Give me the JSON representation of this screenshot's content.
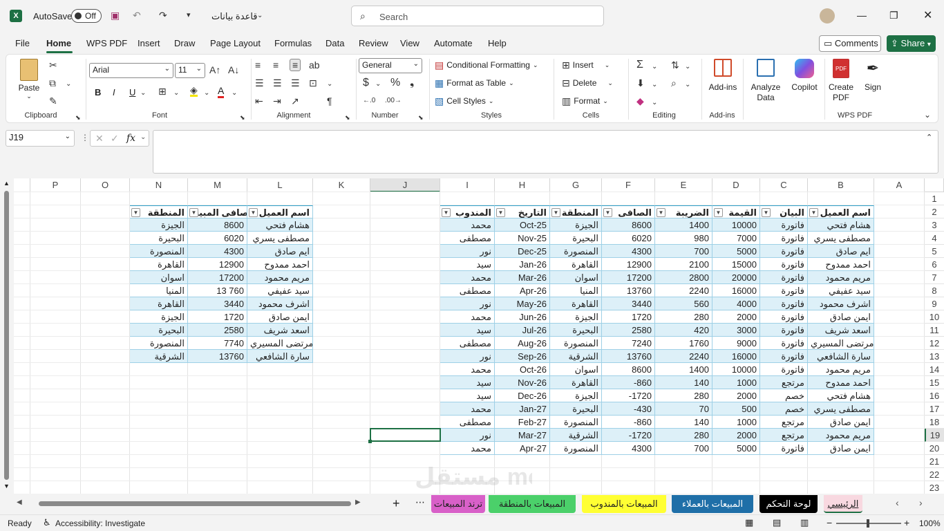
{
  "titlebar": {
    "autosave_label": "AutoSave",
    "autosave_state": "Off",
    "file_name": "قاعدة بيانات",
    "search_placeholder": "Search"
  },
  "menu": [
    "File",
    "Home",
    "WPS PDF",
    "Insert",
    "Draw",
    "Page Layout",
    "Formulas",
    "Data",
    "Review",
    "View",
    "Automate",
    "Help"
  ],
  "menu_active": "Home",
  "comments_label": "Comments",
  "share_label": "Share",
  "ribbon": {
    "clipboard": {
      "label": "Clipboard",
      "paste": "Paste"
    },
    "font": {
      "label": "Font",
      "name": "Arial",
      "size": "11"
    },
    "alignment": {
      "label": "Alignment"
    },
    "number": {
      "label": "Number",
      "format": "General"
    },
    "styles": {
      "label": "Styles",
      "cond": "Conditional Formatting",
      "table": "Format as Table",
      "cell": "Cell Styles"
    },
    "cells": {
      "label": "Cells",
      "insert": "Insert",
      "delete": "Delete",
      "format": "Format"
    },
    "editing": {
      "label": "Editing"
    },
    "addins": {
      "label": "Add-ins",
      "btn": "Add-ins"
    },
    "analyze": "Analyze Data",
    "copilot": "Copilot",
    "wps": {
      "label": "WPS PDF",
      "create": "Create PDF",
      "sign": "Sign"
    }
  },
  "formula_bar": {
    "name_box": "J19",
    "fx": "fx",
    "content": ""
  },
  "columns": [
    "P",
    "O",
    "N",
    "M",
    "L",
    "K",
    "J",
    "I",
    "H",
    "G",
    "F",
    "E",
    "D",
    "C",
    "B",
    "A"
  ],
  "rows": [
    "1",
    "2",
    "3",
    "4",
    "5",
    "6",
    "7",
    "8",
    "9",
    "10",
    "11",
    "12",
    "13",
    "14",
    "15",
    "16",
    "17",
    "18",
    "19",
    "20",
    "21",
    "22",
    "23"
  ],
  "table1": {
    "headers": [
      "اسم العميل",
      "البيان",
      "القيمة",
      "الضريبة",
      "الصافى",
      "المنطقة",
      "التاريخ",
      "المندوب"
    ],
    "rows": [
      [
        "هشام فتحي",
        "فاتورة",
        "10000",
        "1400",
        "8600",
        "الجيزة",
        "Oct-25",
        "محمد"
      ],
      [
        "مصطفى يسري",
        "فاتورة",
        "7000",
        "980",
        "6020",
        "البحيرة",
        "Nov-25",
        "مصطفى"
      ],
      [
        "ايم صادق",
        "فاتورة",
        "5000",
        "700",
        "4300",
        "المنصورة",
        "Dec-25",
        "نور"
      ],
      [
        "احمد ممدوح",
        "فاتورة",
        "15000",
        "2100",
        "12900",
        "القاهرة",
        "Jan-26",
        "سيد"
      ],
      [
        "مريم محمود",
        "فاتورة",
        "20000",
        "2800",
        "17200",
        "اسوان",
        "Mar-26",
        "محمد"
      ],
      [
        "سيد عفيفي",
        "فاتورة",
        "16000",
        "2240",
        "13760",
        "المنيا",
        "Apr-26",
        "مصطفى"
      ],
      [
        "اشرف محمود",
        "فاتورة",
        "4000",
        "560",
        "3440",
        "القاهرة",
        "May-26",
        "نور"
      ],
      [
        "ايمن صادق",
        "فاتورة",
        "2000",
        "280",
        "1720",
        "الجيزة",
        "Jun-26",
        "محمد"
      ],
      [
        "اسعد شريف",
        "فاتورة",
        "3000",
        "420",
        "2580",
        "البحيرة",
        "Jul-26",
        "سيد"
      ],
      [
        "مرتضى المسيري",
        "فاتورة",
        "9000",
        "1760",
        "7240",
        "المنصورة",
        "Aug-26",
        "مصطفى"
      ],
      [
        "سارة الشافعي",
        "فاتورة",
        "16000",
        "2240",
        "13760",
        "الشرقية",
        "Sep-26",
        "نور"
      ],
      [
        "مريم محمود",
        "فاتورة",
        "10000",
        "1400",
        "8600",
        "اسوان",
        "Oct-26",
        "محمد"
      ],
      [
        "احمد ممدوح",
        "مرتجع",
        "1000",
        "140",
        "-860",
        "القاهرة",
        "Nov-26",
        "سيد"
      ],
      [
        "هشام فتحي",
        "خصم",
        "2000",
        "280",
        "-1720",
        "الجيزة",
        "Dec-26",
        "سيد"
      ],
      [
        "مصطفى يسري",
        "خصم",
        "500",
        "70",
        "-430",
        "البحيرة",
        "Jan-27",
        "محمد"
      ],
      [
        "ايمن صادق",
        "مرتجع",
        "1000",
        "140",
        "-860",
        "المنصورة",
        "Feb-27",
        "مصطفى"
      ],
      [
        "مريم محمود",
        "مرتجع",
        "2000",
        "280",
        "-1720",
        "الشرقية",
        "Mar-27",
        "نور"
      ],
      [
        "ايمن صادق",
        "فاتورة",
        "5000",
        "700",
        "4300",
        "المنصورة",
        "Apr-27",
        "محمد"
      ]
    ]
  },
  "table2": {
    "headers": [
      "اسم العميل",
      "صافى المبيعا",
      "المنطقة"
    ],
    "rows": [
      [
        "هشام فتحي",
        "8600",
        "الجيزة"
      ],
      [
        "مصطفى يسري",
        "6020",
        "البحيرة"
      ],
      [
        "ايم صادق",
        "4300",
        "المنصورة"
      ],
      [
        "احمد ممدوح",
        "12900",
        "القاهرة"
      ],
      [
        "مريم محمود",
        "17200",
        "اسوان"
      ],
      [
        "سيد عفيفي",
        "13 760",
        "المنيا"
      ],
      [
        "اشرف محمود",
        "3440",
        "القاهرة"
      ],
      [
        "ايمن صادق",
        "1720",
        "الجيزة"
      ],
      [
        "اسعد شريف",
        "2580",
        "البحيرة"
      ],
      [
        "مرتضى المسيري",
        "7740",
        "المنصورة"
      ],
      [
        "سارة الشافعي",
        "13760",
        "الشرقية"
      ]
    ]
  },
  "sheet_tabs": [
    {
      "label": "الرئيسي",
      "bg": "#f8d8e0",
      "color": "#222"
    },
    {
      "label": "لوحة التحكم",
      "bg": "#000000",
      "color": "#ffffff"
    },
    {
      "label": "المبيعات بالعملاء",
      "bg": "#1f6fa8",
      "color": "#ffffff"
    },
    {
      "label": "المبيعات بالمندوب",
      "bg": "#ffff33",
      "color": "#222"
    },
    {
      "label": "المبيعات بالمنطقة",
      "bg": "#4bd06a",
      "color": "#222"
    },
    {
      "label": "ترند المبيعات",
      "bg": "#d860c8",
      "color": "#222"
    }
  ],
  "status": {
    "ready": "Ready",
    "accessibility": "Accessibility: Investigate",
    "zoom": "100%"
  },
  "watermark": "مستقل mostaql.com"
}
